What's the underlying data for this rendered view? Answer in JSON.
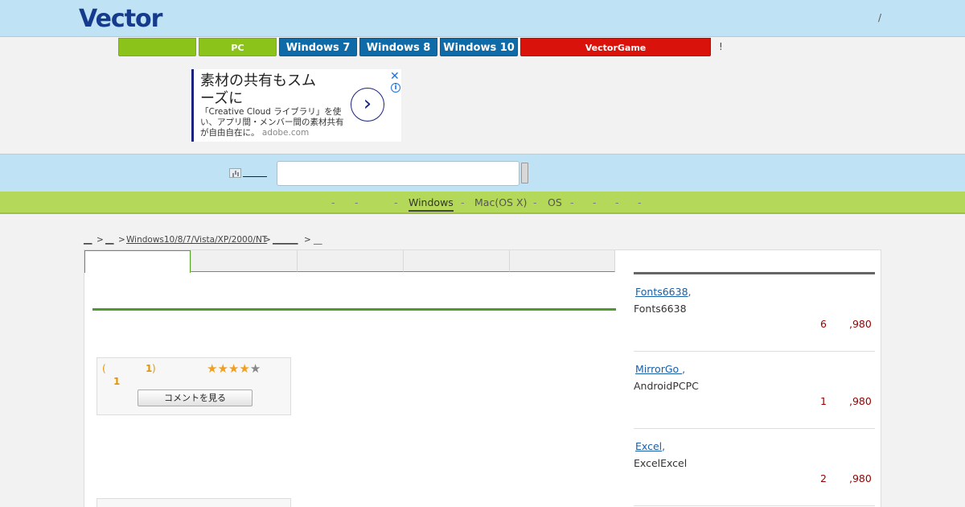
{
  "header": {
    "logo": "Vector",
    "slash": "/"
  },
  "nav": {
    "tabs": [
      {
        "label": ""
      },
      {
        "label": "PC"
      },
      {
        "label": "Windows 7"
      },
      {
        "label": "Windows 8"
      },
      {
        "label": "Windows 10"
      },
      {
        "label": "VectorGame"
      }
    ],
    "trailing": "!"
  },
  "ad": {
    "title": "素材の共有もスムーズに",
    "body": "「Creative Cloud ライブラリ」を使い、アプリ間・メンバー間の素材共有が自由自在に。",
    "domain": "adobe.com",
    "arrow": "›",
    "close": "✕",
    "info": "i"
  },
  "search": {
    "placeholder": ""
  },
  "categories": [
    {
      "label": "-"
    },
    {
      "label": "-"
    },
    {
      "label": "-"
    },
    {
      "label": "Windows",
      "active": true
    },
    {
      "label": "-"
    },
    {
      "label": "Mac(OS X)"
    },
    {
      "label": "-"
    },
    {
      "label": "OS"
    },
    {
      "label": "-"
    },
    {
      "label": "-"
    },
    {
      "label": "-"
    },
    {
      "label": "-"
    }
  ],
  "breadcrumb": [
    {
      "label": "__",
      "link": true
    },
    {
      "label": ">"
    },
    {
      "label": "__",
      "link": true
    },
    {
      "label": ">"
    },
    {
      "label": "Windows10/8/7/Vista/XP/2000/NT",
      "link": true
    },
    {
      "label": ">"
    },
    {
      "label": "______",
      "link": true
    },
    {
      "label": ">"
    },
    {
      "label": "__"
    }
  ],
  "rating": {
    "open_paren": "(",
    "count": "1",
    "close_paren": ")",
    "number": "1",
    "stars": 4,
    "stars_max": 5,
    "comment_button": "コメントを見る",
    "low_box": "_"
  },
  "sidebar": {
    "items": [
      {
        "title": "Fonts6638",
        "title_suffix": ",",
        "subtitle": "Fonts6638",
        "rank": "6",
        "price": ",980"
      },
      {
        "title": "MirrorGo ",
        "title_suffix": ",",
        "subtitle": "AndroidPCPC",
        "rank": "1",
        "price": ",980"
      },
      {
        "title": "Excel",
        "title_suffix": ",",
        "subtitle": "ExcelExcel",
        "rank": "2",
        "price": ",980"
      }
    ]
  },
  "colors": {
    "header_bg": "#bfe3f5",
    "nav_green": "#8cc31a",
    "nav_blue": "#0f6aa8",
    "nav_red": "#d9130b",
    "category_band": "#b4d85a",
    "accent_green": "#4e9a2a",
    "price_red": "#990000"
  }
}
